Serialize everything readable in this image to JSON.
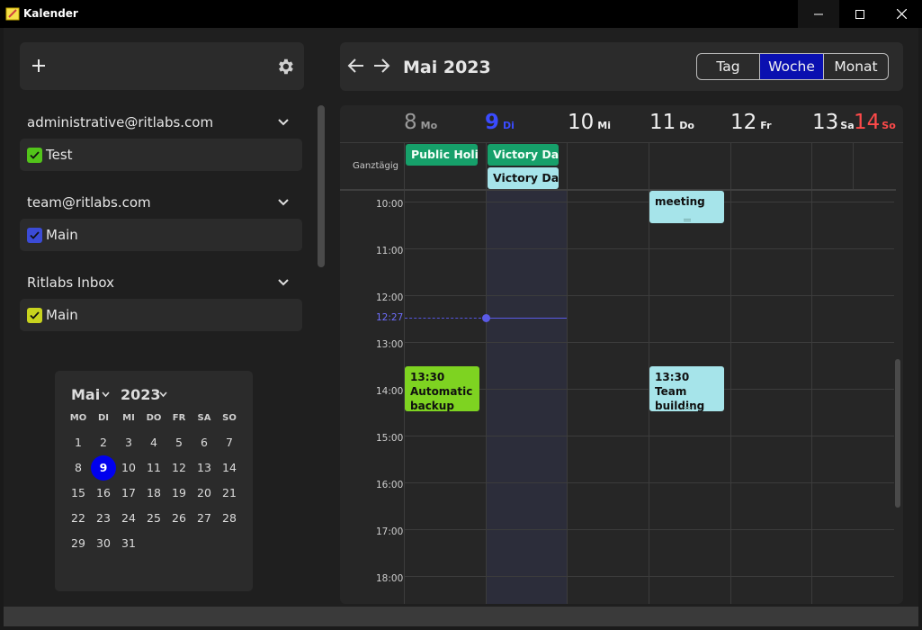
{
  "window": {
    "title": "Kalender"
  },
  "colors": {
    "accent": "#0000ee",
    "week_button": "#0a10b0",
    "holiday_green": "#16a06a",
    "victory_blue": "#a6e4ea",
    "backup_green": "#7ed321",
    "meeting_blue": "#a6e4ea",
    "now_line": "#5a5ae6",
    "sunday_red": "#ff4a4a",
    "today_blue": "#3a4bff"
  },
  "sidebar": {
    "accounts": [
      {
        "email": "administrative@ritlabs.com",
        "calendar": "Test",
        "check_color": "#52c41a"
      },
      {
        "email": "team@ritlabs.com",
        "calendar": "Main",
        "check_color": "#3b4bd6"
      },
      {
        "email": "Ritlabs Inbox",
        "calendar": "Main",
        "check_color": "#c8d31e"
      }
    ]
  },
  "mini_calendar": {
    "month": "Mai",
    "year": "2023",
    "weekdays": [
      "MO",
      "DI",
      "MI",
      "DO",
      "FR",
      "SA",
      "SO"
    ],
    "days": [
      "1",
      "2",
      "3",
      "4",
      "5",
      "6",
      "7",
      "8",
      "9",
      "10",
      "11",
      "12",
      "13",
      "14",
      "15",
      "16",
      "17",
      "18",
      "19",
      "20",
      "21",
      "22",
      "23",
      "24",
      "25",
      "26",
      "27",
      "28",
      "29",
      "30",
      "31"
    ],
    "selected": "9"
  },
  "header": {
    "title": "Mai 2023",
    "views": {
      "day": "Tag",
      "week": "Woche",
      "month": "Monat"
    },
    "active_view": "Woche"
  },
  "week": {
    "days": [
      {
        "num": "8",
        "wd": "Mo"
      },
      {
        "num": "9",
        "wd": "Di"
      },
      {
        "num": "10",
        "wd": "Mi"
      },
      {
        "num": "11",
        "wd": "Do"
      },
      {
        "num": "12",
        "wd": "Fr"
      },
      {
        "num": "13",
        "wd": "Sa"
      },
      {
        "num": "14",
        "wd": "So"
      }
    ],
    "allday_label": "Ganztägig",
    "hours": [
      "10:00",
      "11:00",
      "12:00",
      "13:00",
      "14:00",
      "15:00",
      "16:00",
      "17:00",
      "18:00"
    ],
    "now": "12:27",
    "allday_events": [
      {
        "title": "Public Holi...",
        "day": "Mo"
      },
      {
        "title": "Victory Day",
        "day": "Di"
      },
      {
        "title": "Victory Day",
        "day": "Di"
      }
    ],
    "events": [
      {
        "title": "meeting",
        "day": "Do"
      },
      {
        "title": "13:30 Automatic backup",
        "day": "Mo"
      },
      {
        "title": "13:30 Team building",
        "day": "Do"
      }
    ]
  }
}
